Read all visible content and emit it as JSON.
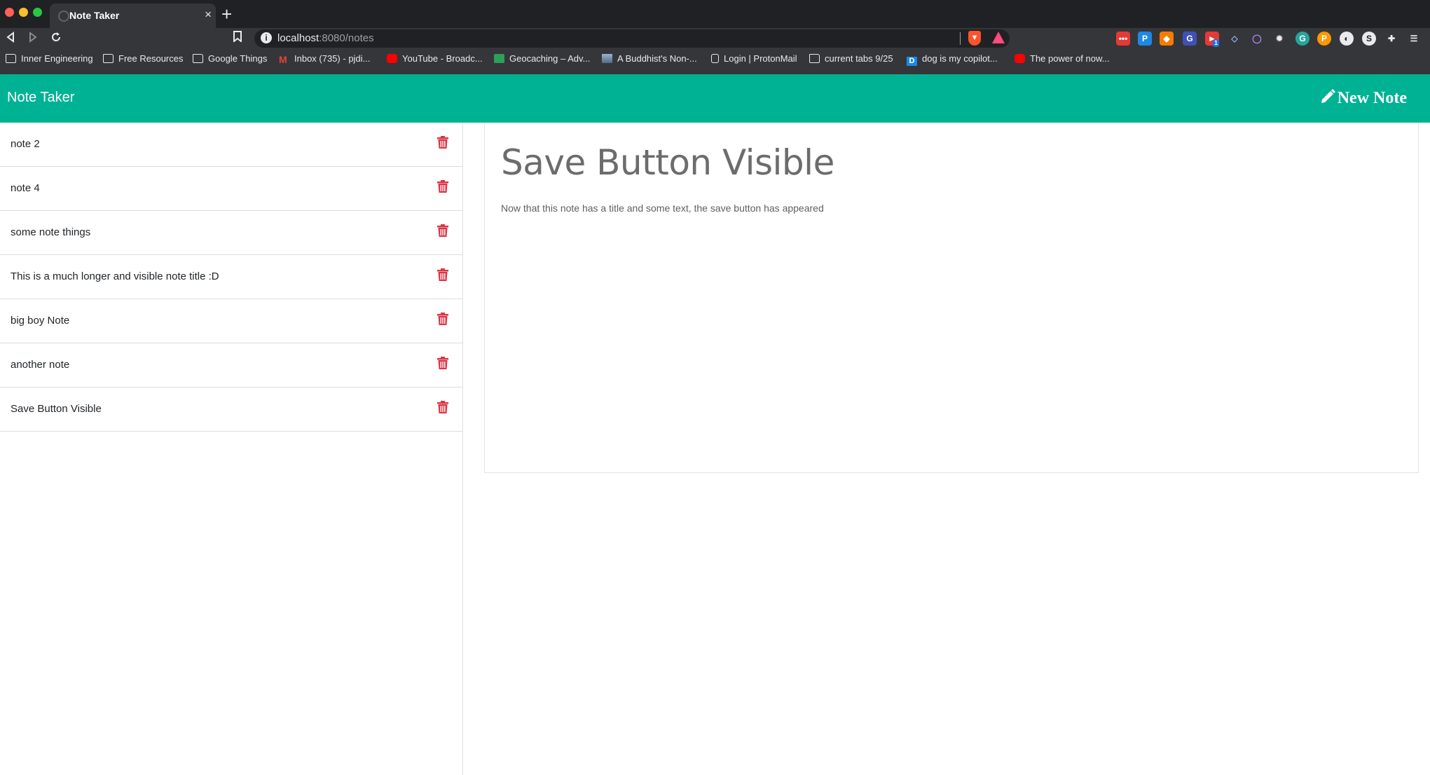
{
  "browser": {
    "tab_title": "Note Taker",
    "url_host": "localhost",
    "url_path": ":8080/notes",
    "bookmarks": [
      {
        "label": "Inner Engineering",
        "icon": "folder-icon"
      },
      {
        "label": "Free Resources",
        "icon": "folder-icon"
      },
      {
        "label": "Google Things",
        "icon": "folder-icon"
      },
      {
        "label": "Inbox (735) - pjdi...",
        "icon": "gmail-icon"
      },
      {
        "label": "YouTube - Broadc...",
        "icon": "youtube-icon"
      },
      {
        "label": "Geocaching – Adv...",
        "icon": "geocaching-icon"
      },
      {
        "label": "A Buddhist's Non-...",
        "icon": "image-icon"
      },
      {
        "label": "Login | ProtonMail",
        "icon": "lock-icon"
      },
      {
        "label": "current tabs 9/25",
        "icon": "folder-icon"
      },
      {
        "label": "dog is my copilot...",
        "icon": "d-logo-icon"
      },
      {
        "label": "The power of now...",
        "icon": "youtube-icon"
      }
    ],
    "extension_badge": "1"
  },
  "app": {
    "brand": "Note Taker",
    "new_note_label": "New Note",
    "accent_color": "#00b294",
    "trash_color": "#dc3545"
  },
  "notes": [
    {
      "title": "note 2"
    },
    {
      "title": "note 4"
    },
    {
      "title": "some note things"
    },
    {
      "title": "This is a much longer and visible note title :D"
    },
    {
      "title": "big boy Note"
    },
    {
      "title": "another note"
    },
    {
      "title": "Save Button Visible"
    }
  ],
  "active_note": {
    "title": "Save Button Visible",
    "text": "Now that this note has a title and some text, the save button has appeared"
  }
}
